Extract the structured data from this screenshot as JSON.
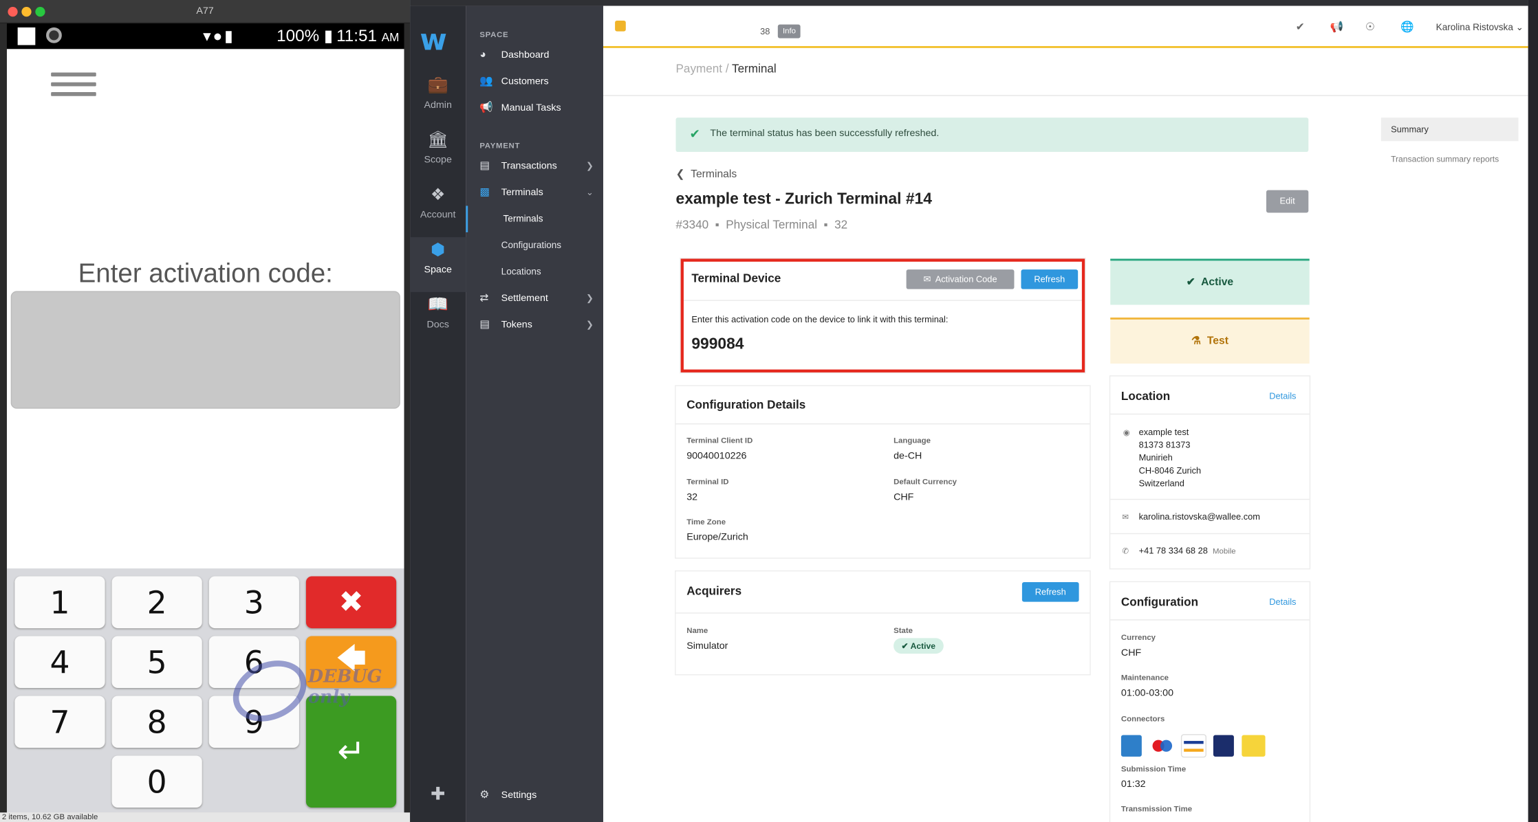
{
  "emulator": {
    "title": "A77",
    "status": {
      "battery": "100%",
      "time": "11:51",
      "ampm": "AM"
    },
    "prompt": "Enter activation code:",
    "keys": [
      "1",
      "2",
      "3",
      "4",
      "5",
      "6",
      "7",
      "8",
      "9",
      "0"
    ],
    "watermark": "DEBUG only",
    "footer": "2 items, 10.62 GB available"
  },
  "rail": {
    "logo": "w",
    "items": [
      {
        "label": "Admin",
        "icon": "briefcase-icon"
      },
      {
        "label": "Scope",
        "icon": "bank-icon"
      },
      {
        "label": "Account",
        "icon": "cubes-icon"
      },
      {
        "label": "Space",
        "icon": "cube-icon"
      },
      {
        "label": "Docs",
        "icon": "book-icon"
      }
    ]
  },
  "nav": {
    "space_section": "SPACE",
    "payment_section": "PAYMENT",
    "dashboard": "Dashboard",
    "customers": "Customers",
    "manual_tasks": "Manual Tasks",
    "transactions": "Transactions",
    "terminals": "Terminals",
    "sub_terminals": "Terminals",
    "configurations": "Configurations",
    "locations": "Locations",
    "settlement": "Settlement",
    "tokens": "Tokens",
    "settings": "Settings"
  },
  "topbar": {
    "count": "38",
    "info": "Info",
    "user": "Karolina Ristovska"
  },
  "breadcrumb": {
    "parent": "Payment",
    "separator": "/",
    "current": "Terminal"
  },
  "alert": "The terminal status has been successfully refreshed.",
  "back_link": "Terminals",
  "terminal": {
    "title": "example test - Zurich Terminal #14",
    "id": "#3340",
    "type": "Physical Terminal",
    "serial_partial": "32",
    "edit": "Edit"
  },
  "device_card": {
    "title": "Terminal Device",
    "activation_button": "Activation Code",
    "refresh_button": "Refresh",
    "instruction": "Enter this activation code on the device to link it with this terminal:",
    "code": "999084"
  },
  "config_details": {
    "title": "Configuration Details",
    "client_id_label": "Terminal Client ID",
    "client_id": "90040010226",
    "language_label": "Language",
    "language": "de-CH",
    "terminal_id_label": "Terminal ID",
    "terminal_id": "32",
    "currency_label": "Default Currency",
    "currency": "CHF",
    "timezone_label": "Time Zone",
    "timezone": "Europe/Zurich"
  },
  "acquirers": {
    "title": "Acquirers",
    "refresh": "Refresh",
    "name_label": "Name",
    "name": "Simulator",
    "state_label": "State",
    "state": "Active"
  },
  "status": {
    "active": "Active",
    "test": "Test"
  },
  "location": {
    "title": "Location",
    "details": "Details",
    "address": [
      "example test",
      "81373 81373",
      "Munirieh",
      "CH-8046 Zurich",
      "Switzerland"
    ],
    "email": "karolina.ristovska@wallee.com",
    "phone": "+41 78 334 68 28",
    "phone_type": "Mobile"
  },
  "configuration": {
    "title": "Configuration",
    "details": "Details",
    "currency_label": "Currency",
    "currency": "CHF",
    "maintenance_label": "Maintenance",
    "maintenance": "01:00-03:00",
    "connectors_label": "Connectors",
    "submission_label": "Submission Time",
    "submission": "01:32",
    "transmission_label": "Transmission Time"
  },
  "summary": {
    "title": "Summary",
    "sub": "Transaction summary reports"
  },
  "colors": {
    "accent": "#2f97de",
    "alert_bg": "#d9efe7",
    "highlight": "#e5281d",
    "topbar_line": "#f2c12e"
  }
}
